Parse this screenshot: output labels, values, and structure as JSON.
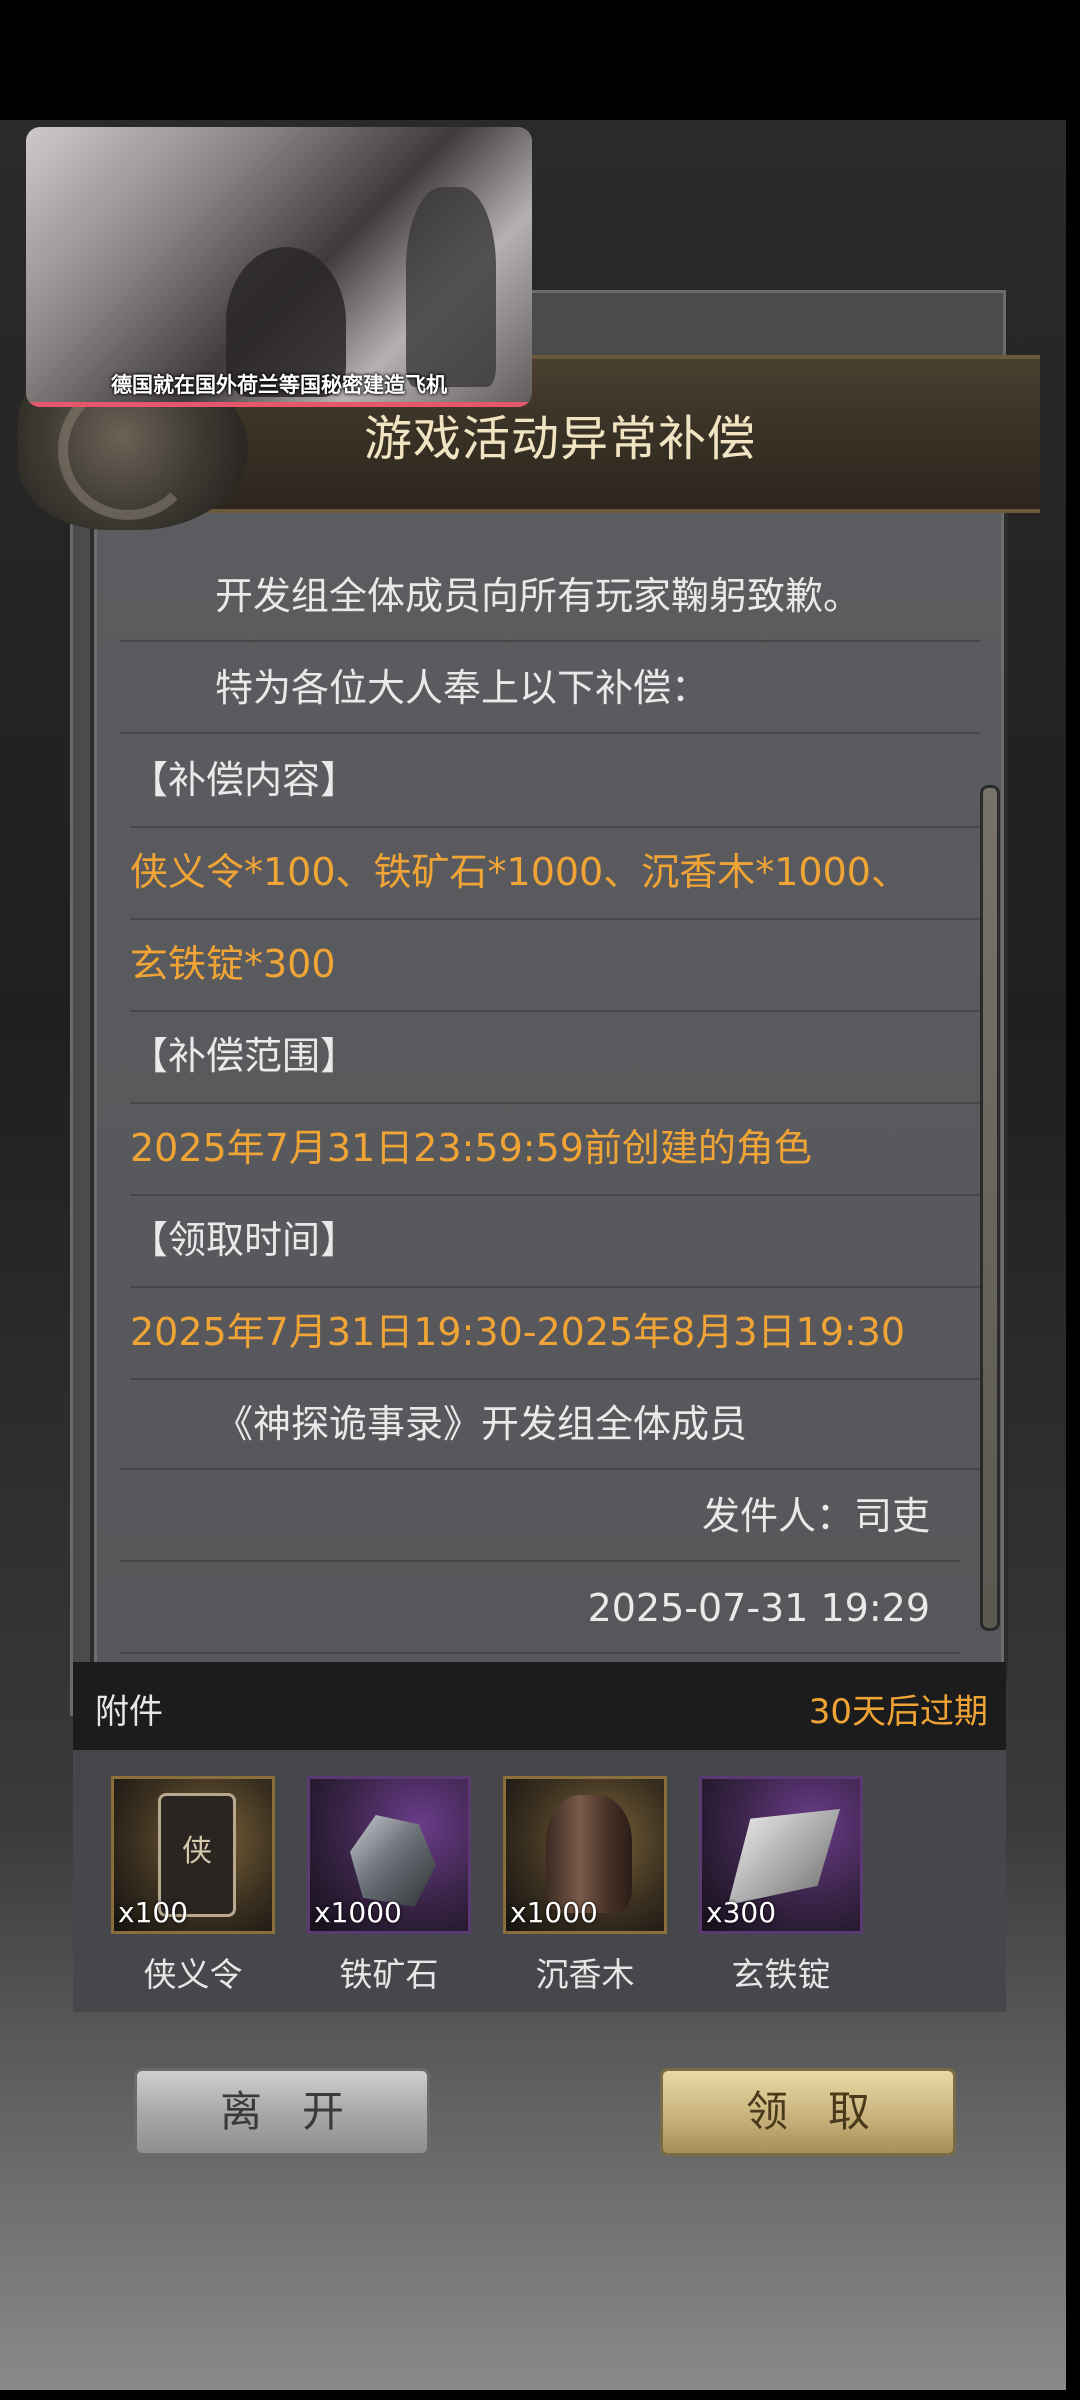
{
  "video": {
    "caption": "德国就在国外荷兰等国秘密建造飞机"
  },
  "mail": {
    "title": "游戏活动异常补偿",
    "lines": [
      "开发组全体成员向所有玩家鞠躬致歉。",
      "特为各位大人奉上以下补偿：",
      "【补偿内容】",
      "侠义令*100、铁矿石*1000、沉香木*1000、",
      "玄铁锭*300",
      "【补偿范围】",
      "2025年7月31日23:59:59前创建的角色",
      "【领取时间】",
      "2025年7月31日19:30-2025年8月3日19:30",
      "《神探诡事录》开发组全体成员",
      "发件人：司吏",
      "2025-07-31 19:29"
    ]
  },
  "attachments": {
    "label": "附件",
    "expire": "30天后过期",
    "items": [
      {
        "name": "侠义令",
        "count": "x100",
        "icon": "token-icon"
      },
      {
        "name": "铁矿石",
        "count": "x1000",
        "icon": "ore-icon"
      },
      {
        "name": "沉香木",
        "count": "x1000",
        "icon": "wood-icon"
      },
      {
        "name": "玄铁锭",
        "count": "x300",
        "icon": "ingot-icon"
      }
    ]
  },
  "buttons": {
    "leave": "离开",
    "claim": "领取"
  },
  "colors": {
    "highlight": "#f0a436",
    "banner_text": "#f1e4c2"
  }
}
